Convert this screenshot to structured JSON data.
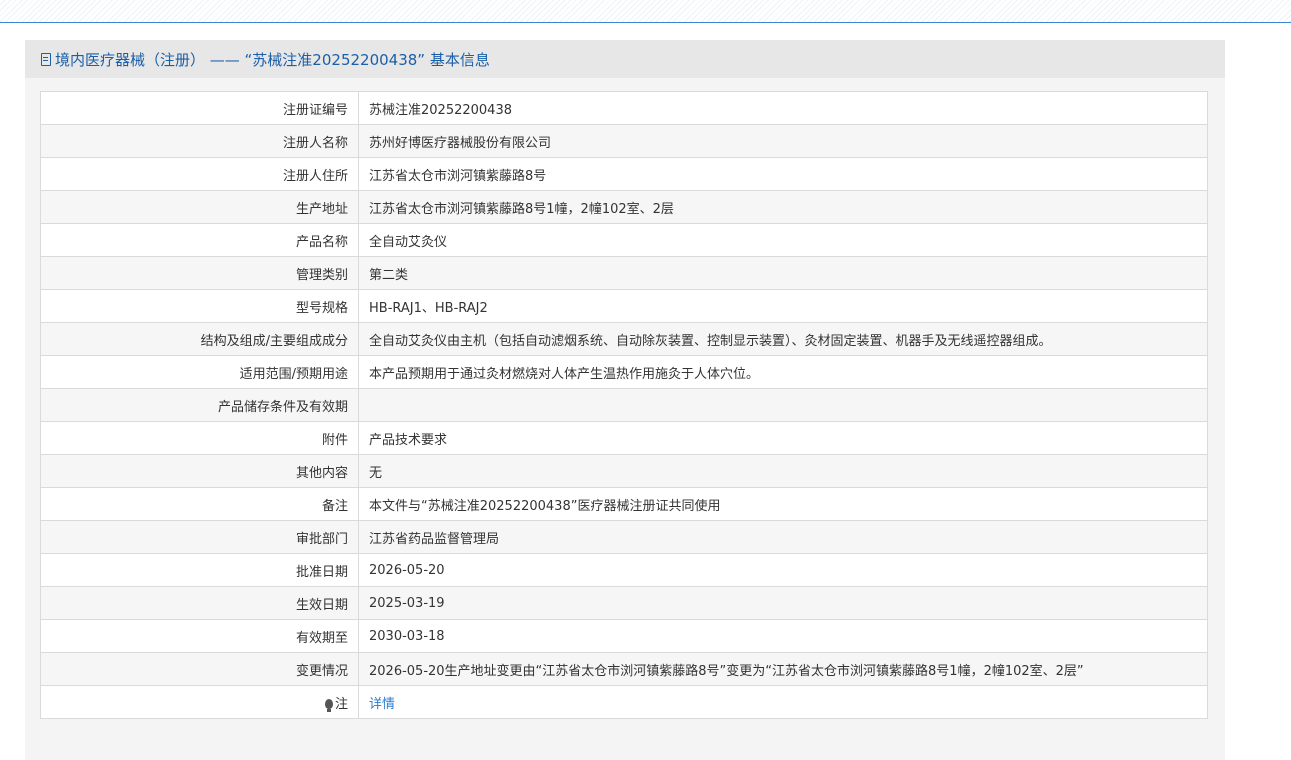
{
  "header": {
    "title": "境内医疗器械（注册） —— “苏械注准20252200438” 基本信息",
    "icon": "document-icon"
  },
  "rows": [
    {
      "label": "注册证编号",
      "value": "苏械注准20252200438"
    },
    {
      "label": "注册人名称",
      "value": "苏州好博医疗器械股份有限公司"
    },
    {
      "label": "注册人住所",
      "value": "江苏省太仓市浏河镇紫藤路8号"
    },
    {
      "label": "生产地址",
      "value": "江苏省太仓市浏河镇紫藤路8号1幢，2幢102室、2层"
    },
    {
      "label": "产品名称",
      "value": "全自动艾灸仪"
    },
    {
      "label": "管理类别",
      "value": "第二类"
    },
    {
      "label": "型号规格",
      "value": "HB-RAJ1、HB-RAJ2"
    },
    {
      "label": "结构及组成/主要组成成分",
      "value": "全自动艾灸仪由主机（包括自动滤烟系统、自动除灰装置、控制显示装置）、灸材固定装置、机器手及无线遥控器组成。"
    },
    {
      "label": "适用范围/预期用途",
      "value": "本产品预期用于通过灸材燃烧对人体产生温热作用施灸于人体穴位。"
    },
    {
      "label": "产品储存条件及有效期",
      "value": ""
    },
    {
      "label": "附件",
      "value": "产品技术要求"
    },
    {
      "label": "其他内容",
      "value": "无"
    },
    {
      "label": "备注",
      "value": "本文件与“苏械注准20252200438”医疗器械注册证共同使用"
    },
    {
      "label": "审批部门",
      "value": "江苏省药品监督管理局"
    },
    {
      "label": "批准日期",
      "value": "2026-05-20"
    },
    {
      "label": "生效日期",
      "value": "2025-03-19"
    },
    {
      "label": "有效期至",
      "value": "2030-03-18"
    },
    {
      "label": "变更情况",
      "value": "2026-05-20生产地址变更由“江苏省太仓市浏河镇紫藤路8号”变更为“江苏省太仓市浏河镇紫藤路8号1幢，2幢102室、2层”"
    }
  ],
  "note": {
    "icon": "lightbulb-icon",
    "label": "注",
    "link": "详情"
  },
  "colors": {
    "accent": "#1a5fa8",
    "link": "#2a7ccf",
    "border": "#dadada"
  }
}
